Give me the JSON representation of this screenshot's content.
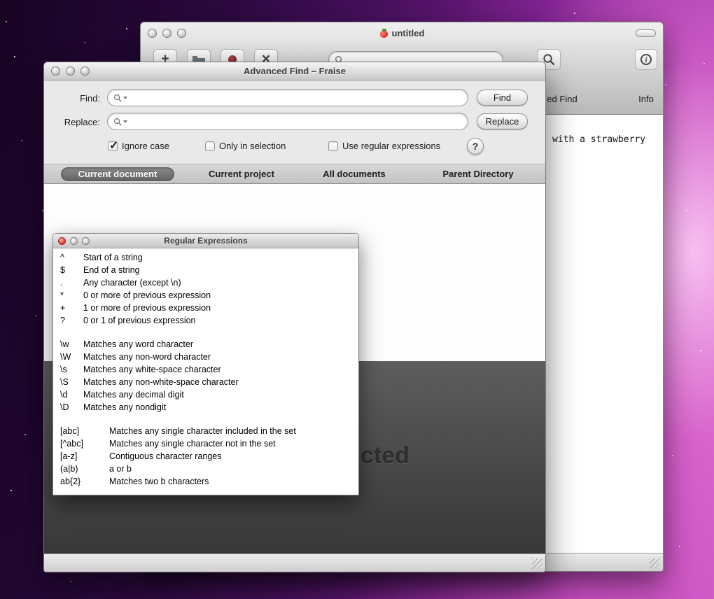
{
  "editor_window": {
    "title": "untitled",
    "toolbar": {
      "search_value": "",
      "advanced_find_label": "ed Find",
      "info_label": "Info"
    },
    "document_text": "with a strawberry"
  },
  "find_window": {
    "title": "Advanced Find – Fraise",
    "find": {
      "label": "Find:",
      "value": "",
      "button": "Find"
    },
    "replace": {
      "label": "Replace:",
      "value": "",
      "button": "Replace"
    },
    "options": [
      {
        "label": "Ignore case",
        "checked": true
      },
      {
        "label": "Only in selection",
        "checked": false
      },
      {
        "label": "Use regular expressions",
        "checked": false
      }
    ],
    "help_label": "?",
    "scopes": [
      {
        "label": "Current document",
        "selected": true
      },
      {
        "label": "Current project",
        "selected": false
      },
      {
        "label": "All documents",
        "selected": false
      },
      {
        "label": "Parent Directory",
        "selected": false
      }
    ],
    "results_fragment": "cted"
  },
  "regex_panel": {
    "title": "Regular Expressions",
    "groups": [
      {
        "rows": [
          {
            "token": "^",
            "desc": "Start of a string"
          },
          {
            "token": "$",
            "desc": "End of a string"
          },
          {
            "token": ".",
            "desc": "Any character (except \\n)"
          },
          {
            "token": "*",
            "desc": "0 or more of previous expression"
          },
          {
            "token": "+",
            "desc": "1 or more of previous expression"
          },
          {
            "token": "?",
            "desc": "0 or 1 of previous expression"
          }
        ]
      },
      {
        "rows": [
          {
            "token": "\\w",
            "desc": "Matches any word character"
          },
          {
            "token": "\\W",
            "desc": "Matches any non-word character"
          },
          {
            "token": "\\s",
            "desc": "Matches any white-space character"
          },
          {
            "token": "\\S",
            "desc": "Matches any non-white-space character"
          },
          {
            "token": "\\d",
            "desc": "Matches any decimal digit"
          },
          {
            "token": "\\D",
            "desc": "Matches any nondigit"
          }
        ]
      },
      {
        "rows": [
          {
            "token": "[abc]",
            "desc": "Matches any single character included in the set"
          },
          {
            "token": "[^abc]",
            "desc": "Matches any single character not in the set"
          },
          {
            "token": "[a-z]",
            "desc": "Contiguous character ranges"
          },
          {
            "token": "(a|b)",
            "desc": "a or b"
          },
          {
            "token": "ab{2}",
            "desc": "Matches two b characters"
          }
        ]
      }
    ]
  }
}
